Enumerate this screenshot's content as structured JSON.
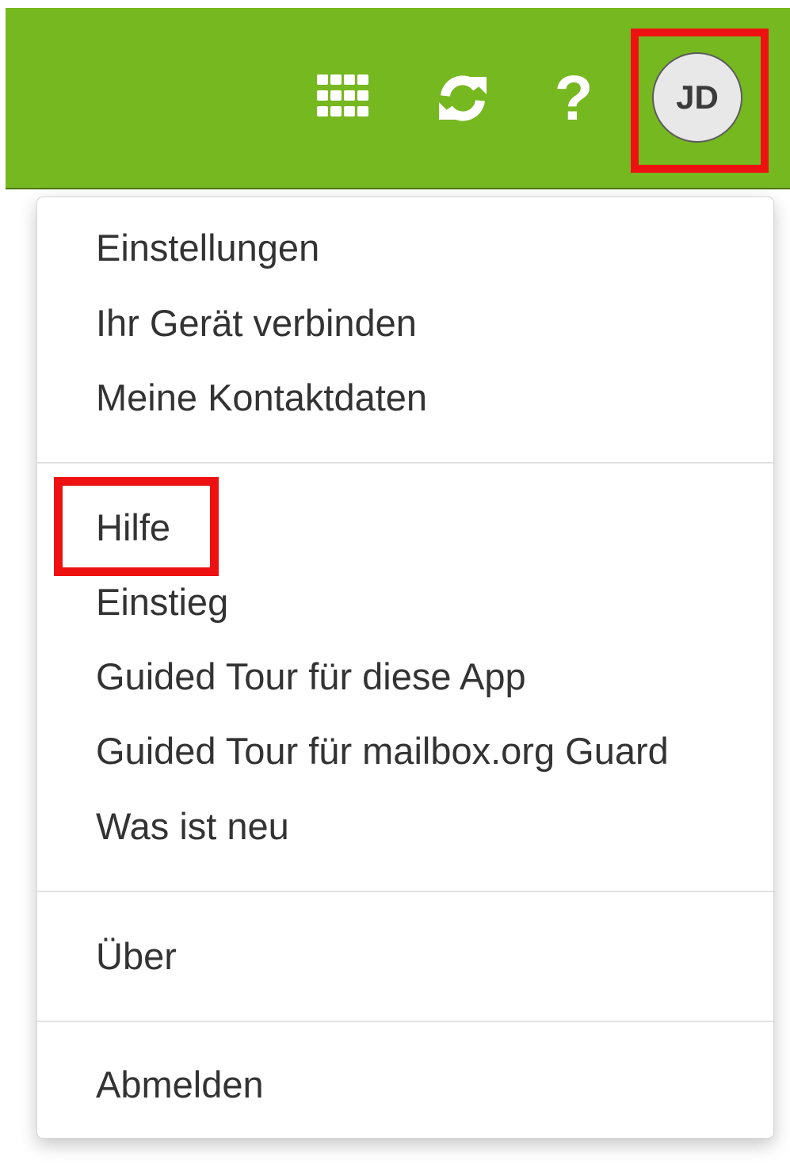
{
  "header": {
    "background_color": "#76b820",
    "apps_icon": "grid-icon",
    "refresh_icon": "refresh-icon",
    "help_icon": "question-mark-icon",
    "help_glyph": "?",
    "avatar_initials": "JD"
  },
  "menu": {
    "group1": [
      "Einstellungen",
      "Ihr Gerät verbinden",
      "Meine Kontaktdaten"
    ],
    "group2": [
      "Hilfe",
      "Einstieg",
      "Guided Tour für diese App",
      "Guided Tour für mailbox.org Guard",
      "Was ist neu"
    ],
    "group3": [
      "Über"
    ],
    "group4": [
      "Abmelden"
    ]
  },
  "annotations": {
    "highlight_color": "#ee1111"
  }
}
